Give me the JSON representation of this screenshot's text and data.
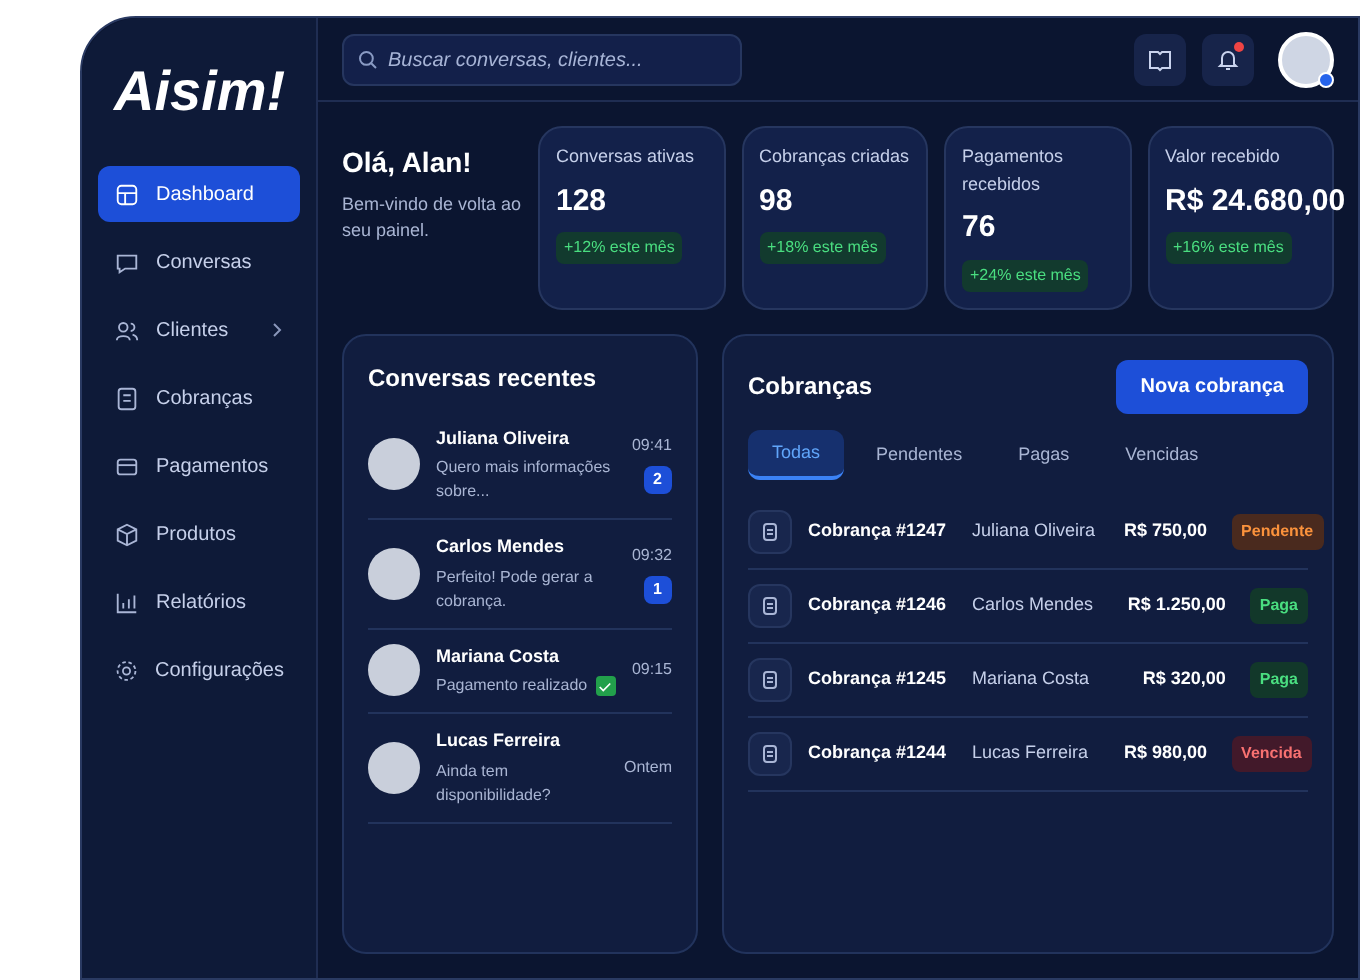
{
  "logo": "Aisim!",
  "sidebar": {
    "items": [
      {
        "label": "Dashboard",
        "selected": true,
        "expandable": false
      },
      {
        "label": "Conversas",
        "selected": false,
        "expandable": false
      },
      {
        "label": "Clientes",
        "selected": false,
        "expandable": true
      },
      {
        "label": "Cobranças",
        "selected": false,
        "expandable": false
      },
      {
        "label": "Pagamentos",
        "selected": false,
        "expandable": false
      },
      {
        "label": "Produtos",
        "selected": false,
        "expandable": false
      },
      {
        "label": "Relatórios",
        "selected": false,
        "expandable": false
      },
      {
        "label": "Configurações",
        "selected": false,
        "expandable": false
      }
    ]
  },
  "topbar": {
    "search": {
      "placeholder": "Buscar conversas, clientes..."
    },
    "notifications": true,
    "online": true
  },
  "greeting": {
    "title": "Olá, Alan!",
    "subtitle": "Bem-vindo de volta ao seu painel."
  },
  "stats": [
    {
      "label": "Conversas ativas",
      "value": "128",
      "change": "+12% este mês"
    },
    {
      "label": "Cobranças criadas",
      "value": "98",
      "change": "+18% este mês"
    },
    {
      "label": "Pagamentos recebidos",
      "value": "76",
      "change": "+24% este mês"
    },
    {
      "label": "Valor recebido",
      "value": "R$ 24.680,00",
      "change": "+16% este mês"
    }
  ],
  "conversations": {
    "title": "Conversas recentes",
    "items": [
      {
        "name": "Juliana Oliveira",
        "message": "Quero mais informações sobre...",
        "time": "09:41",
        "unread": "2",
        "confirmed": false
      },
      {
        "name": "Carlos Mendes",
        "message": "Perfeito! Pode gerar a cobrança.",
        "time": "09:32",
        "unread": "1",
        "confirmed": false
      },
      {
        "name": "Mariana Costa",
        "message": "Pagamento realizado",
        "time": "09:15",
        "confirmed": true
      },
      {
        "name": "Lucas Ferreira",
        "message": "Ainda tem disponibilidade?",
        "time": "Ontem",
        "confirmed": false
      }
    ]
  },
  "charges": {
    "title": "Cobranças",
    "button": "Nova cobrança",
    "tabs": [
      {
        "label": "Todas",
        "selected": true
      },
      {
        "label": "Pendentes",
        "selected": false
      },
      {
        "label": "Pagas",
        "selected": false
      },
      {
        "label": "Vencidas",
        "selected": false
      }
    ],
    "rows": [
      {
        "id": "Cobrança #1247",
        "client": "Juliana Oliveira",
        "amount": "R$ 750,00",
        "status": "Pendente",
        "kind": "pending"
      },
      {
        "id": "Cobrança #1246",
        "client": "Carlos Mendes",
        "amount": "R$ 1.250,00",
        "status": "Paga",
        "kind": "paid"
      },
      {
        "id": "Cobrança #1245",
        "client": "Mariana Costa",
        "amount": "R$ 320,00",
        "status": "Paga",
        "kind": "paid"
      },
      {
        "id": "Cobrança #1244",
        "client": "Lucas Ferreira",
        "amount": "R$ 980,00",
        "status": "Vencida",
        "kind": "overdue"
      }
    ]
  }
}
